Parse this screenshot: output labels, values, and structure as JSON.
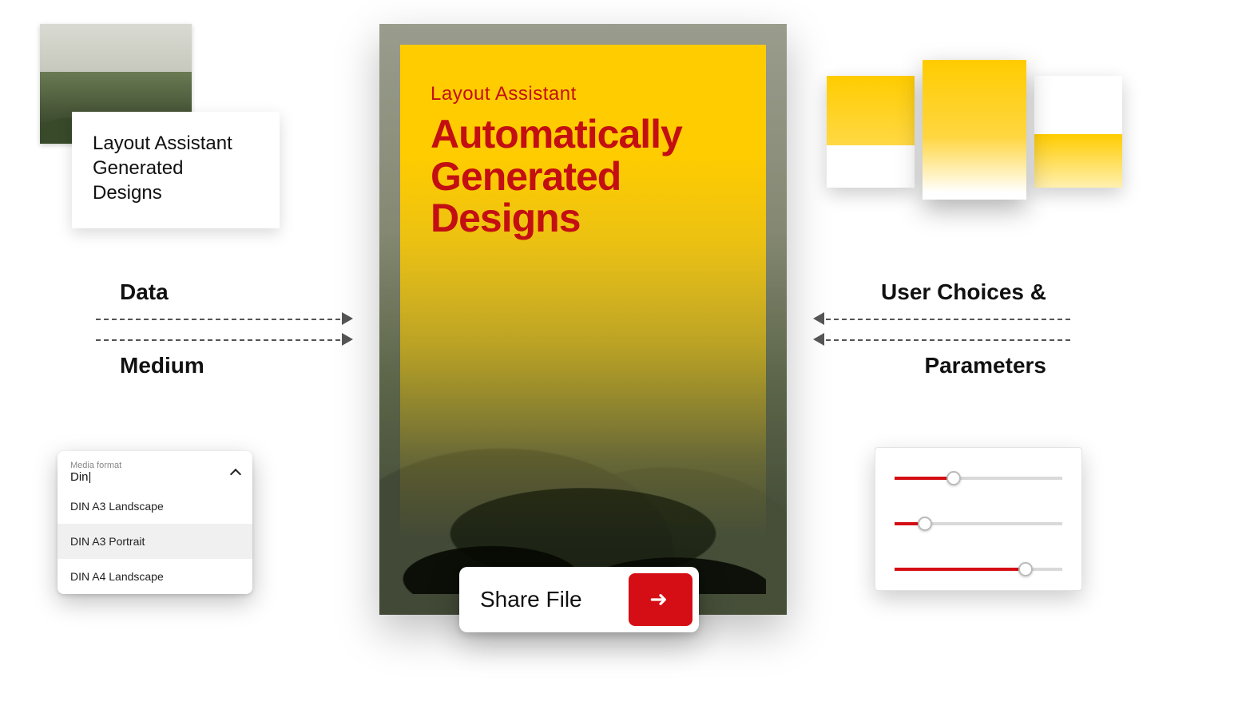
{
  "left": {
    "text_card": "Layout Assistant\nGenerated\nDesigns",
    "arrow_top_label": "Data",
    "arrow_bottom_label": "Medium",
    "dropdown": {
      "label": "Media format",
      "value": "Din|",
      "options": [
        "DIN A3 Landscape",
        "DIN A3 Portrait",
        "DIN A4 Landscape"
      ],
      "selected_index": 1
    }
  },
  "center": {
    "kicker": "Layout Assistant",
    "title": "Automatically\nGenerated\nDesigns",
    "share_label": "Share File"
  },
  "right": {
    "arrow_top_label": "User Choices &",
    "arrow_bottom_label": "Parameters",
    "sliders": [
      {
        "value": 0.35
      },
      {
        "value": 0.18
      },
      {
        "value": 0.78
      }
    ]
  },
  "colors": {
    "accent_yellow": "#ffcc00",
    "accent_red": "#d40e14",
    "title_red": "#c30f12"
  }
}
